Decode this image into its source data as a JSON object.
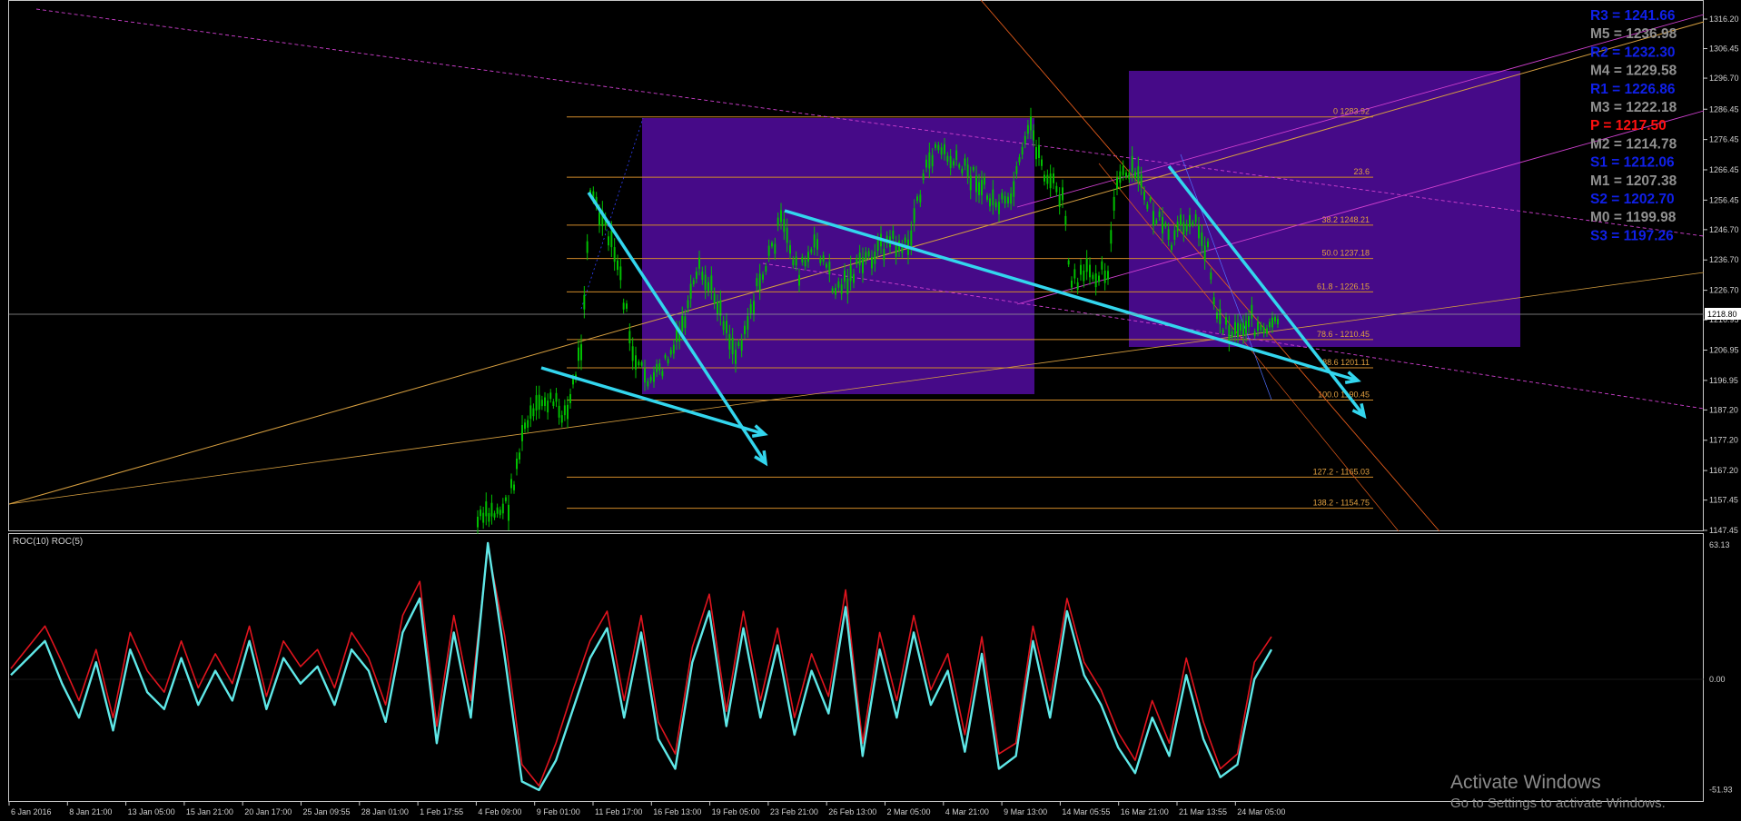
{
  "colors": {
    "background": "#000000",
    "grid_border": "#c8c8c8",
    "candle_up": "#00c000",
    "candle_down": "#00c000",
    "fib_line": "#d08a2a",
    "fib_text": "#e0a040",
    "trend_cyan": "#33d6ee",
    "box_fill": "#4a0b8f",
    "channel_magenta": "#d040d0",
    "channel_orange": "#d8a040",
    "roc10": "#e0141e",
    "roc5": "#5fe8e8",
    "pivot_r": "#1020e8",
    "pivot_m": "#909090",
    "pivot_p": "#ff1010",
    "price_label": "#ffffff"
  },
  "indicator_label": "ROC(10)  ROC(5)",
  "price_axis": {
    "labels": [
      "1316.20",
      "1306.45",
      "1296.70",
      "1286.45",
      "1276.45",
      "1266.45",
      "1256.45",
      "1246.70",
      "1236.70",
      "1226.70",
      "1216.95",
      "1206.95",
      "1196.95",
      "1187.20",
      "1177.20",
      "1167.20",
      "1157.45",
      "1147.45"
    ],
    "current_price": "1218.80"
  },
  "indicator_axis": {
    "labels": [
      "63.13",
      "0.00",
      "-51.93"
    ]
  },
  "time_axis": {
    "labels": [
      "6 Jan 2016",
      "8 Jan 21:00",
      "13 Jan 05:00",
      "15 Jan 21:00",
      "20 Jan 17:00",
      "25 Jan 09:55",
      "28 Jan 01:00",
      "1 Feb 17:55",
      "4 Feb 09:00",
      "9 Feb 01:00",
      "11 Feb 17:00",
      "16 Feb 13:00",
      "19 Feb 05:00",
      "23 Feb 21:00",
      "26 Feb 13:00",
      "2 Mar 05:00",
      "4 Mar 21:00",
      "9 Mar 13:00",
      "14 Mar 05:55",
      "16 Mar 21:00",
      "21 Mar 13:55",
      "24 Mar 05:00"
    ]
  },
  "pivots": [
    {
      "label": "R3 = 1241.66",
      "kind": "r"
    },
    {
      "label": "M5 = 1236.98",
      "kind": "m"
    },
    {
      "label": "R2 = 1232.30",
      "kind": "r"
    },
    {
      "label": "M4 = 1229.58",
      "kind": "m"
    },
    {
      "label": "R1 = 1226.86",
      "kind": "r"
    },
    {
      "label": "M3 = 1222.18",
      "kind": "m"
    },
    {
      "label": "P  = 1217.50",
      "kind": "p"
    },
    {
      "label": "M2 = 1214.78",
      "kind": "m"
    },
    {
      "label": "S1 = 1212.06",
      "kind": "r"
    },
    {
      "label": "M1 = 1207.38",
      "kind": "m"
    },
    {
      "label": "S2 = 1202.70",
      "kind": "r"
    },
    {
      "label": "M0 = 1199.98",
      "kind": "m"
    },
    {
      "label": "S3 = 1197.26",
      "kind": "r"
    }
  ],
  "fib_levels": [
    {
      "label": "0 1283.92",
      "price": 1283.92
    },
    {
      "label": "23.6",
      "price": 1264.0
    },
    {
      "label": "38.2 1248.21",
      "price": 1248.21
    },
    {
      "label": "50.0 1237.18",
      "price": 1237.18
    },
    {
      "label": "61.8 - 1226.15",
      "price": 1226.15
    },
    {
      "label": "78.6 - 1210.45",
      "price": 1210.45
    },
    {
      "label": "88.6 1201.11",
      "price": 1201.11
    },
    {
      "label": "100.0 1190.45",
      "price": 1190.45
    },
    {
      "label": "127.2 - 1165.03",
      "price": 1165.03
    },
    {
      "label": "138.2 - 1154.75",
      "price": 1154.75
    }
  ],
  "watermark": {
    "title": "Activate Windows",
    "subtitle": "Go to Settings to activate Windows."
  },
  "chart_data": {
    "type": "line",
    "title": "",
    "price_range": [
      1145,
      1318
    ],
    "indicator_range": [
      -55,
      65
    ],
    "price_path_approx": [
      {
        "t": "4 Feb 09:00",
        "price": 1150
      },
      {
        "t": "9 Feb 01:00",
        "price": 1195
      },
      {
        "t": "11 Feb 17:00",
        "price": 1258
      },
      {
        "t": "16 Feb 13:00",
        "price": 1195
      },
      {
        "t": "19 Feb 05:00",
        "price": 1210
      },
      {
        "t": "23 Feb 21:00",
        "price": 1240
      },
      {
        "t": "26 Feb 13:00",
        "price": 1228
      },
      {
        "t": "2 Mar 05:00",
        "price": 1245
      },
      {
        "t": "4 Mar 21:00",
        "price": 1275
      },
      {
        "t": "9 Mar 13:00",
        "price": 1283
      },
      {
        "t": "14 Mar 05:55",
        "price": 1230
      },
      {
        "t": "16 Mar 21:00",
        "price": 1268
      },
      {
        "t": "21 Mar 13:55",
        "price": 1250
      },
      {
        "t": "24 Mar 05:00",
        "price": 1213
      }
    ],
    "series": [
      {
        "name": "ROC(10)",
        "values": [
          5,
          15,
          25,
          8,
          -10,
          14,
          -18,
          22,
          4,
          -6,
          18,
          -4,
          12,
          -2,
          25,
          -8,
          18,
          6,
          14,
          -4,
          22,
          10,
          -12,
          30,
          46,
          -22,
          30,
          -10,
          62,
          20,
          -40,
          -50,
          -30,
          -5,
          18,
          32,
          -10,
          30,
          -20,
          -35,
          15,
          40,
          -15,
          32,
          -10,
          24,
          -18,
          12,
          -8,
          42,
          -30,
          22,
          -10,
          30,
          -5,
          12,
          -26,
          20,
          -35,
          -30,
          25,
          -10,
          38,
          8,
          -5,
          -25,
          -38,
          -10,
          -30,
          10,
          -20,
          -42,
          -35,
          8,
          20
        ]
      },
      {
        "name": "ROC(5)",
        "values": [
          2,
          10,
          18,
          -2,
          -18,
          8,
          -24,
          14,
          -6,
          -14,
          10,
          -12,
          4,
          -10,
          18,
          -14,
          10,
          -2,
          6,
          -12,
          14,
          4,
          -20,
          22,
          38,
          -30,
          22,
          -18,
          64,
          10,
          -48,
          -52,
          -38,
          -14,
          10,
          24,
          -18,
          22,
          -28,
          -42,
          8,
          32,
          -22,
          24,
          -18,
          16,
          -26,
          4,
          -16,
          34,
          -36,
          14,
          -18,
          22,
          -12,
          4,
          -34,
          12,
          -42,
          -36,
          18,
          -18,
          32,
          2,
          -12,
          -32,
          -44,
          -18,
          -36,
          2,
          -28,
          -46,
          -40,
          0,
          14
        ]
      }
    ]
  }
}
